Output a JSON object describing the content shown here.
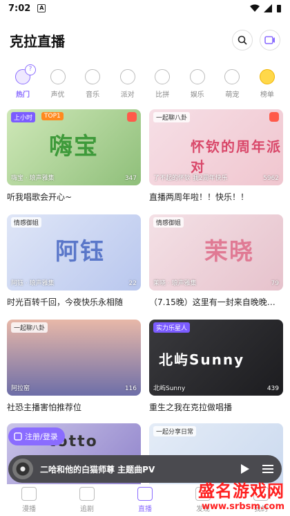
{
  "status": {
    "time": "7:02",
    "a_icon": "A"
  },
  "app": {
    "title": "克拉直播"
  },
  "categories": [
    {
      "label": "热门",
      "icon": "fire-icon",
      "active": true
    },
    {
      "label": "声优",
      "icon": "mic-icon"
    },
    {
      "label": "音乐",
      "icon": "music-icon"
    },
    {
      "label": "派对",
      "icon": "party-icon"
    },
    {
      "label": "比拼",
      "icon": "swords-icon"
    },
    {
      "label": "娱乐",
      "icon": "smile-icon"
    },
    {
      "label": "萌宠",
      "icon": "cat-icon"
    },
    {
      "label": "榜单",
      "icon": "trophy-icon"
    }
  ],
  "rooms": [
    {
      "tag": "上小时",
      "rank": "TOP1",
      "cover_text": "嗨宝",
      "host": "嗨宝 · 琅声雅集",
      "count": "347",
      "title": "听我唱歌会开心~",
      "color_a": "#cfe8b8",
      "color_b": "#8fbf7a",
      "text_color": "#3e9a3a"
    },
    {
      "tag": "一起聊八卦",
      "rank": "",
      "cover_text": "怀钦的周年派对",
      "host": "了不起的怀钦 我2周年快乐",
      "count": "5962",
      "title": "直播两周年啦！！快乐！！",
      "color_a": "#f6dfe6",
      "color_b": "#f0c6cf",
      "text_color": "#d9486a"
    },
    {
      "tag": "情感御姐",
      "rank": "",
      "cover_text": "阿钰",
      "host": "阿钰 · 琅声雅集",
      "count": "22",
      "title": "时光百转千回，今夜快乐永相随",
      "color_a": "#dfe6f7",
      "color_b": "#b9c7ee",
      "text_color": "#5a77c9"
    },
    {
      "tag": "情感御姐",
      "rank": "",
      "cover_text": "茉晓",
      "host": "茉晓 · 琅声雅集",
      "count": "79",
      "title": "（7.15晚）这里有一封来自晚晚的...",
      "color_a": "#f4e1e6",
      "color_b": "#e6c2cc",
      "text_color": "#e07a94"
    },
    {
      "tag": "一起聊八卦",
      "rank": "",
      "cover_text": "",
      "host": "阿拉窑",
      "count": "116",
      "title": "社恐主播害怕推荐位",
      "color_a": "#e8b8a8",
      "color_b": "#6d6ea8",
      "text_color": "#ffffff"
    },
    {
      "tag": "实力乐星人",
      "rank": "",
      "cover_text": "北屿Sunny",
      "host": "北屿Sunny",
      "count": "439",
      "title": "重生之我在克拉做唱播",
      "color_a": "#3a3a3e",
      "color_b": "#1c1c1f",
      "text_color": "#ffffff"
    },
    {
      "tag": "",
      "rank": "",
      "cover_text": "totto",
      "host": "",
      "count": "",
      "title": "",
      "color_a": "#c9c3e8",
      "color_b": "#8c7fc9",
      "text_color": "#333333"
    },
    {
      "tag": "一起分享日常",
      "rank": "",
      "cover_text": "",
      "host": "",
      "count": "",
      "title": "",
      "color_a": "#e4ecf7",
      "color_b": "#c9d8ee",
      "text_color": "#333333"
    }
  ],
  "login": {
    "label": "注册/登录"
  },
  "player": {
    "title": "二哈和他的白猫师尊 主题曲PV"
  },
  "nav": [
    {
      "label": "漫播",
      "icon": "m-logo-icon"
    },
    {
      "label": "追剧",
      "icon": "star-icon"
    },
    {
      "label": "直播",
      "icon": "live-icon",
      "active": true
    },
    {
      "label": "发现",
      "icon": "compass-icon"
    },
    {
      "label": "我的",
      "icon": "user-icon"
    }
  ],
  "watermark": {
    "line1": "盛名游戏网",
    "line2": "www.srbsm.com"
  }
}
